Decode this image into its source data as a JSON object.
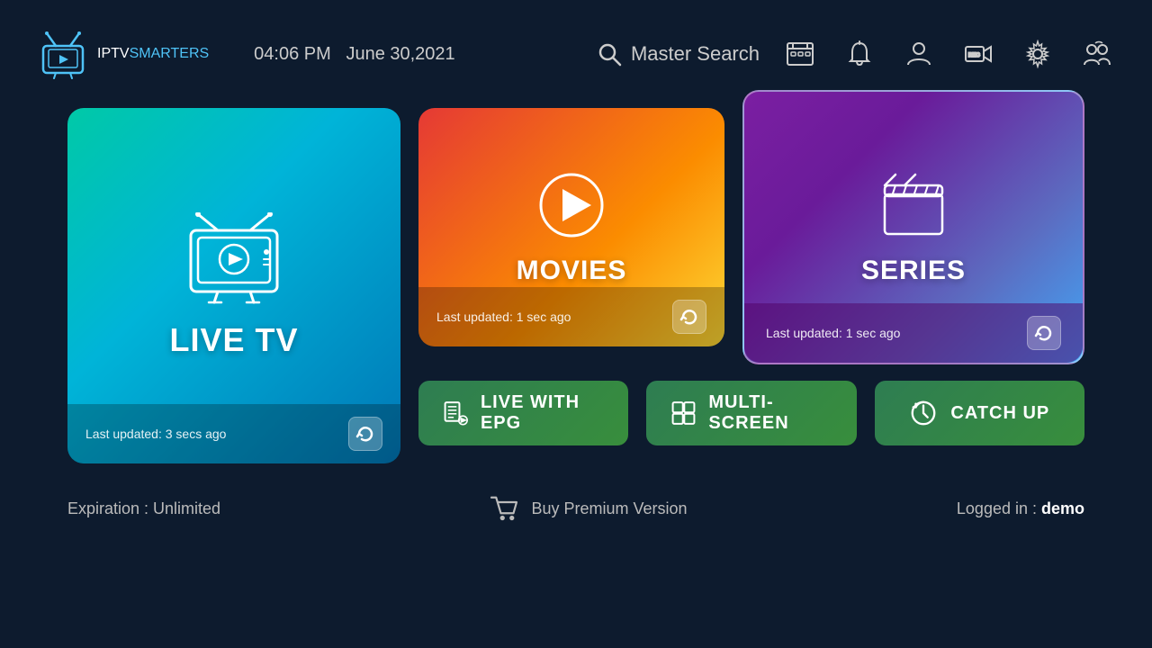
{
  "header": {
    "logo_iptv": "IPTV",
    "logo_smarters": "SMARTERS",
    "time": "04:06 PM",
    "date": "June 30,2021",
    "search_label": "Master Search"
  },
  "icons": {
    "search": "🔍",
    "epg": "📋",
    "bell": "🔔",
    "user": "👤",
    "rec": "📹",
    "settings": "⚙️",
    "multiuser": "👥"
  },
  "cards": {
    "live_tv": {
      "label": "LIVE TV",
      "last_updated": "Last updated: 3 secs ago"
    },
    "movies": {
      "label": "MOVIES",
      "last_updated": "Last updated: 1 sec ago"
    },
    "series": {
      "label": "SERIES",
      "last_updated": "Last updated: 1 sec ago"
    }
  },
  "buttons": {
    "live_epg": "LIVE WITH EPG",
    "multi_screen": "MULTI-SCREEN",
    "catch_up": "CATCH UP"
  },
  "footer": {
    "expiration": "Expiration : Unlimited",
    "buy_premium": "Buy Premium Version",
    "logged_in_label": "Logged in : ",
    "logged_in_user": "demo"
  }
}
